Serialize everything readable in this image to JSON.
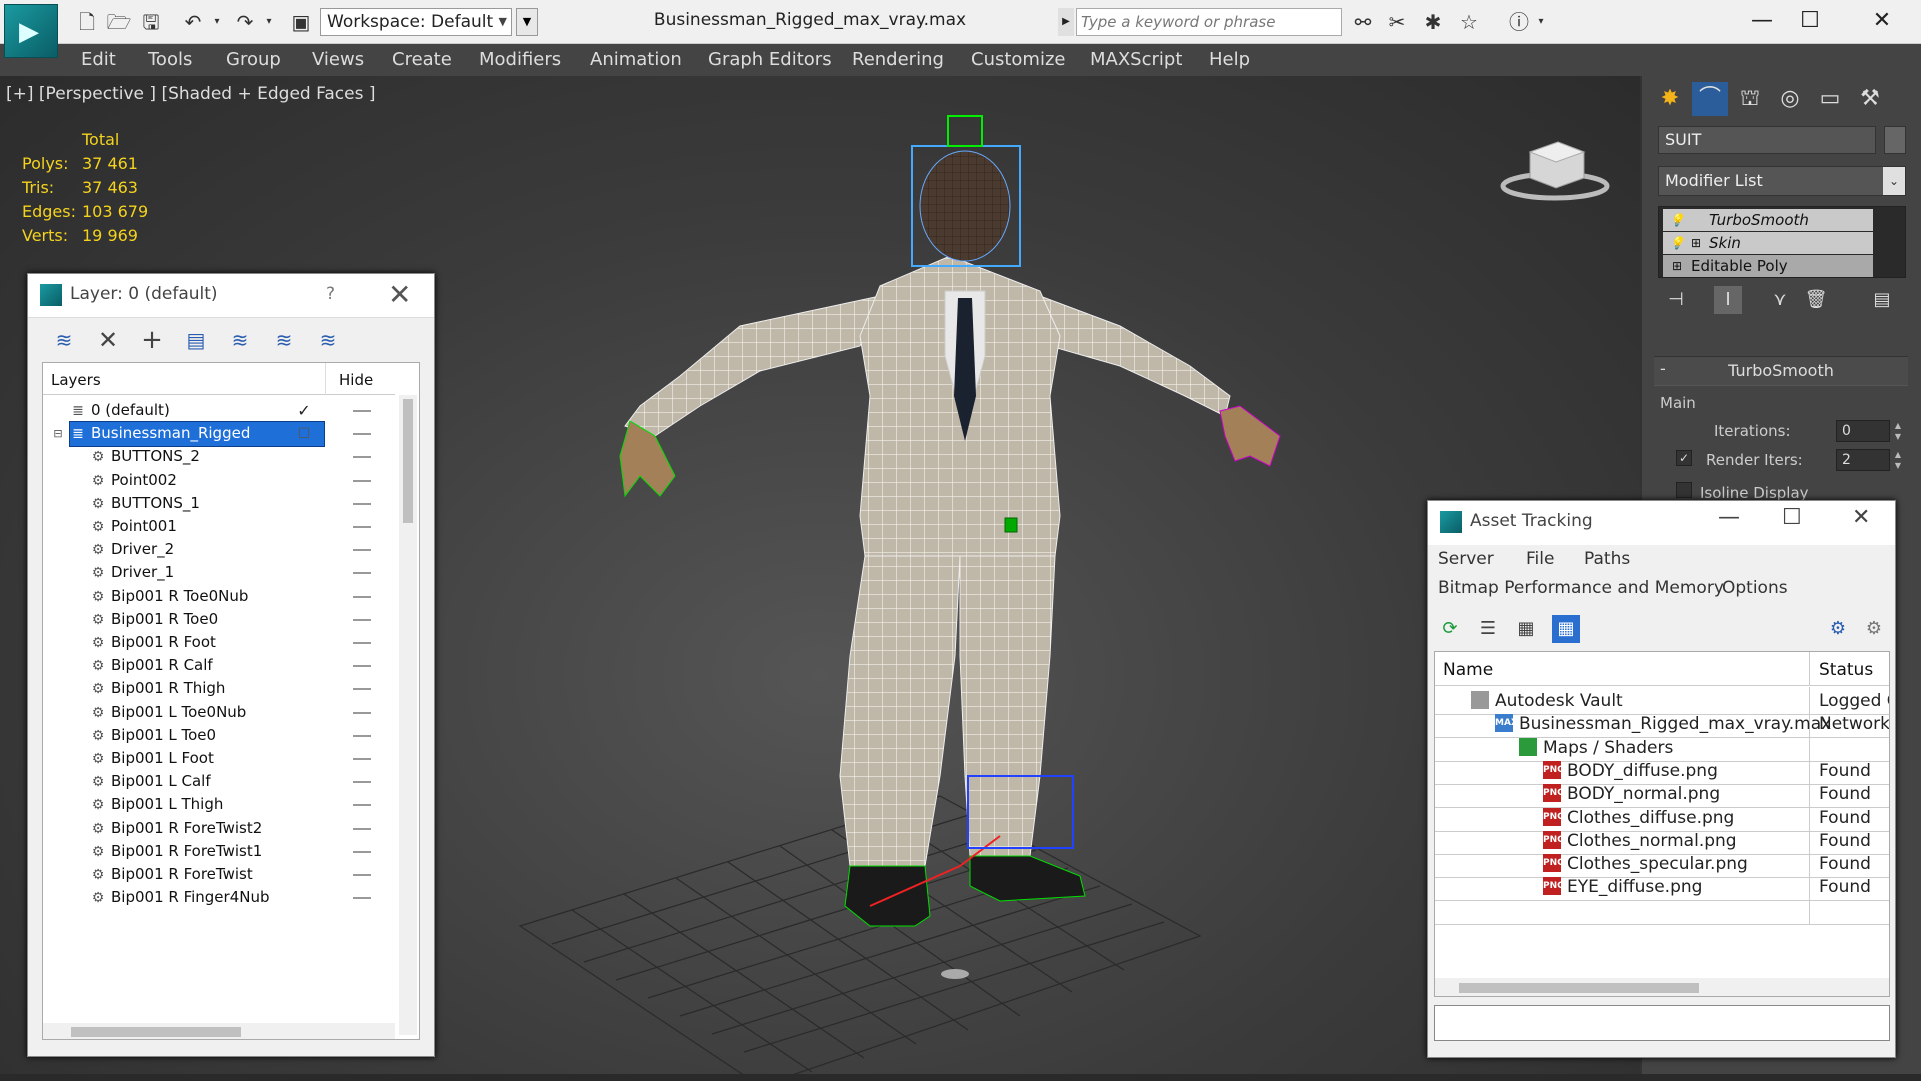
{
  "titlebar": {
    "workspace_label": "Workspace: Default",
    "document_title": "Businessman_Rigged_max_vray.max",
    "search_placeholder": "Type a keyword or phrase",
    "window_controls": [
      "—",
      "☐",
      "✕"
    ]
  },
  "menubar": {
    "items": [
      "Edit",
      "Tools",
      "Group",
      "Views",
      "Create",
      "Modifiers",
      "Animation",
      "Graph Editors",
      "Rendering",
      "Customize",
      "MAXScript",
      "Help"
    ]
  },
  "viewport": {
    "label": "[+] [Perspective ] [Shaded + Edged Faces ]",
    "stats_header": "Total",
    "stats": [
      {
        "key": "Polys:",
        "value": "37 461"
      },
      {
        "key": "Tris:",
        "value": "37 463"
      },
      {
        "key": "Edges:",
        "value": "103 679"
      },
      {
        "key": "Verts:",
        "value": "19 969"
      }
    ]
  },
  "layer_dialog": {
    "title": "Layer: 0 (default)",
    "help": "?",
    "col_layers": "Layers",
    "col_hide": "Hide",
    "layers": [
      {
        "name": "0 (default)",
        "indent": 0,
        "type": "layer",
        "active": true
      },
      {
        "name": "Businessman_Rigged",
        "indent": 0,
        "type": "layer",
        "selected": true
      },
      {
        "name": "BUTTONS_2",
        "indent": 1
      },
      {
        "name": "Point002",
        "indent": 1
      },
      {
        "name": "BUTTONS_1",
        "indent": 1
      },
      {
        "name": "Point001",
        "indent": 1
      },
      {
        "name": "Driver_2",
        "indent": 1
      },
      {
        "name": "Driver_1",
        "indent": 1
      },
      {
        "name": "Bip001 R Toe0Nub",
        "indent": 1
      },
      {
        "name": "Bip001 R Toe0",
        "indent": 1
      },
      {
        "name": "Bip001 R Foot",
        "indent": 1
      },
      {
        "name": "Bip001 R Calf",
        "indent": 1
      },
      {
        "name": "Bip001 R Thigh",
        "indent": 1
      },
      {
        "name": "Bip001 L Toe0Nub",
        "indent": 1
      },
      {
        "name": "Bip001 L Toe0",
        "indent": 1
      },
      {
        "name": "Bip001 L Foot",
        "indent": 1
      },
      {
        "name": "Bip001 L Calf",
        "indent": 1
      },
      {
        "name": "Bip001 L Thigh",
        "indent": 1
      },
      {
        "name": "Bip001 R ForeTwist2",
        "indent": 1
      },
      {
        "name": "Bip001 R ForeTwist1",
        "indent": 1
      },
      {
        "name": "Bip001 R ForeTwist",
        "indent": 1
      },
      {
        "name": "Bip001 R Finger4Nub",
        "indent": 1
      }
    ]
  },
  "command_panel": {
    "object_name": "SUIT",
    "modifier_list": "Modifier List",
    "stack": [
      "TurboSmooth",
      "Skin",
      "Editable Poly"
    ],
    "rollout_title": "TurboSmooth",
    "rollout_collapse": "-",
    "group_main": "Main",
    "iterations_label": "Iterations:",
    "iterations_value": "0",
    "render_iters_label": "Render Iters:",
    "render_iters_value": "2",
    "isoline_label": "Isoline Display"
  },
  "asset_tracking": {
    "title": "Asset Tracking",
    "menu_row1": [
      "Server",
      "File",
      "Paths"
    ],
    "menu_row2": [
      "Bitmap Performance and Memory",
      "Options"
    ],
    "col_name": "Name",
    "col_status": "Status",
    "rows": [
      {
        "name": "Autodesk Vault",
        "status": "Logged O",
        "indent": 0,
        "icon": "vault"
      },
      {
        "name": "Businessman_Rigged_max_vray.max",
        "status": "Network",
        "indent": 1,
        "icon": "max"
      },
      {
        "name": "Maps / Shaders",
        "status": "",
        "indent": 2,
        "icon": "maps"
      },
      {
        "name": "BODY_diffuse.png",
        "status": "Found",
        "indent": 3,
        "icon": "png"
      },
      {
        "name": "BODY_normal.png",
        "status": "Found",
        "indent": 3,
        "icon": "png"
      },
      {
        "name": "Clothes_diffuse.png",
        "status": "Found",
        "indent": 3,
        "icon": "png"
      },
      {
        "name": "Clothes_normal.png",
        "status": "Found",
        "indent": 3,
        "icon": "png"
      },
      {
        "name": "Clothes_specular.png",
        "status": "Found",
        "indent": 3,
        "icon": "png"
      },
      {
        "name": "EYE_diffuse.png",
        "status": "Found",
        "indent": 3,
        "icon": "png"
      }
    ],
    "icon_texts": {
      "png": "PNG",
      "max": "MAX"
    }
  },
  "colors": {
    "selection": "#1e6fd8",
    "stats_text": "#f4d21e",
    "viewport_bg": "#3b3b3b"
  }
}
